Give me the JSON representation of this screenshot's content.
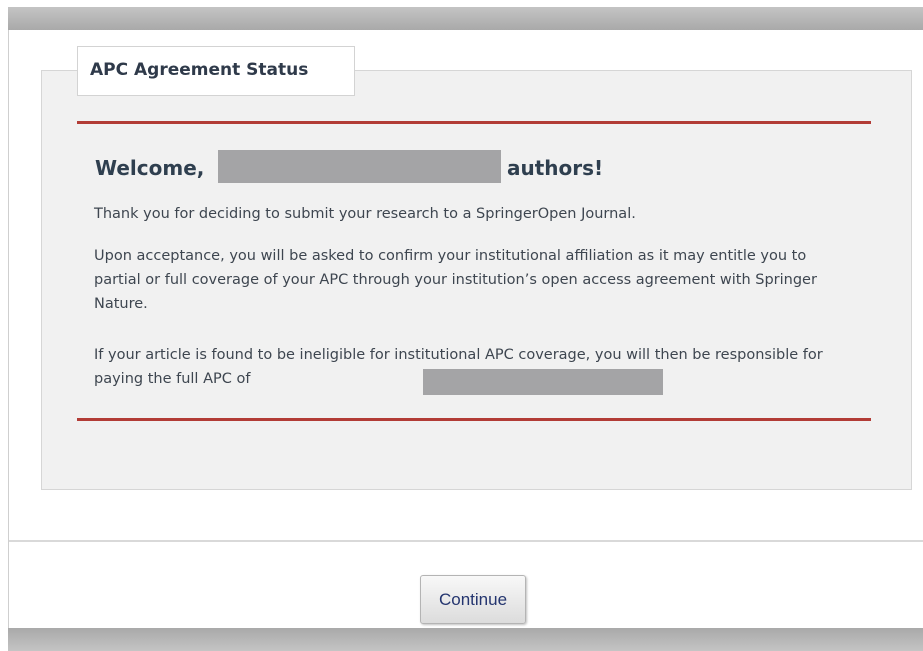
{
  "fieldset": {
    "legend": "APC Agreement Status"
  },
  "welcome": {
    "prefix": "Welcome,",
    "suffix": "authors!"
  },
  "body": {
    "paragraph_1": "Thank you for deciding to submit your research to a SpringerOpen Journal.",
    "paragraph_2": "Upon acceptance, you will be asked to confirm your institutional affiliation as it may entitle you to partial or full coverage of your APC through your institution’s open access agreement with Springer Nature.",
    "paragraph_3": "If your article is found to be ineligible for institutional APC coverage, you will then be responsible for paying the full APC of"
  },
  "footer": {
    "continue_label": "Continue"
  },
  "colors": {
    "rule": "#b23c36",
    "heading": "#2f3f4f",
    "button_text": "#24356f",
    "redaction": "#a4a4a6"
  }
}
